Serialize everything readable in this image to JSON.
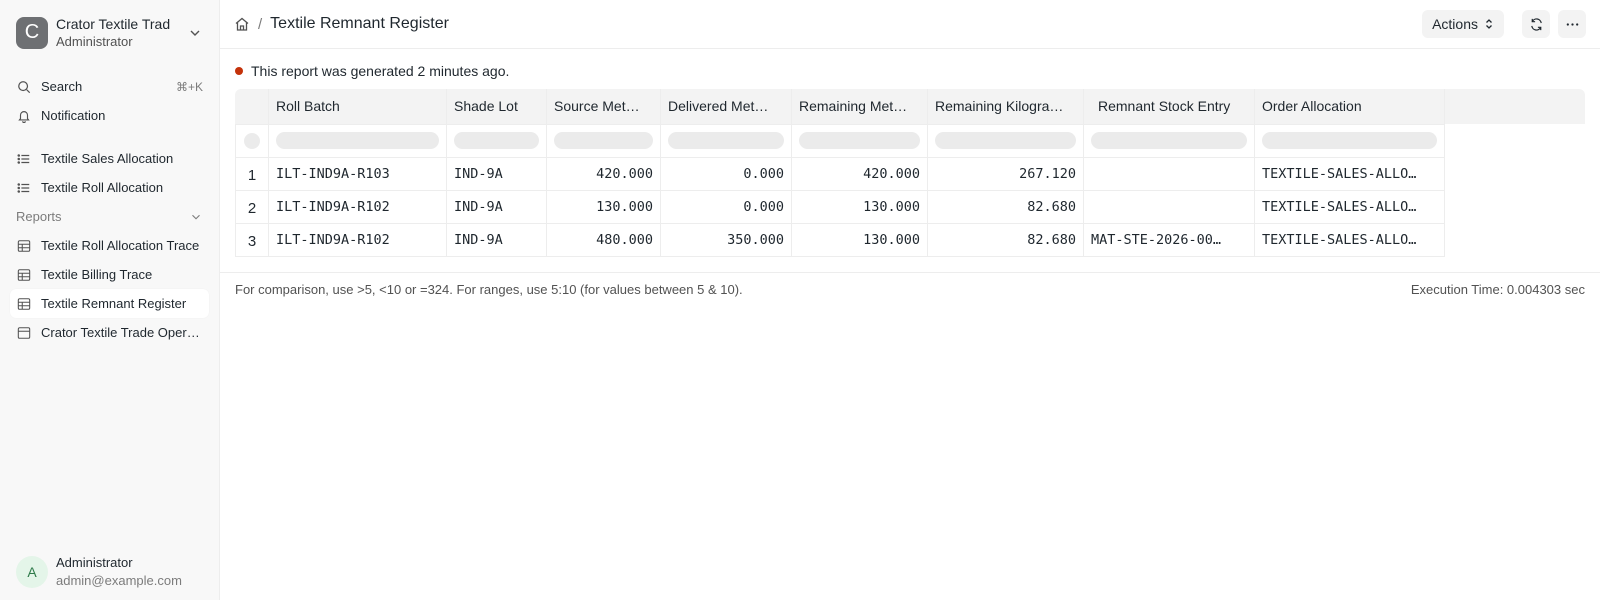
{
  "workspace": {
    "logo_letter": "C",
    "name": "Crator Textile Trad",
    "role": "Administrator"
  },
  "nav": {
    "search_label": "Search",
    "search_shortcut": "⌘+K",
    "notification_label": "Notification",
    "items": [
      {
        "label": "Textile Sales Allocation",
        "icon": "list-icon"
      },
      {
        "label": "Textile Roll Allocation",
        "icon": "list-icon"
      }
    ],
    "reports_section": "Reports",
    "reports": [
      {
        "label": "Textile Roll Allocation Trace",
        "icon": "table-icon"
      },
      {
        "label": "Textile Billing Trace",
        "icon": "table-icon"
      },
      {
        "label": "Textile Remnant Register",
        "icon": "table-icon",
        "active": true
      },
      {
        "label": "Crator Textile Trade Operations",
        "icon": "sheet-icon"
      }
    ]
  },
  "user": {
    "avatar_letter": "A",
    "name": "Administrator",
    "email": "admin@example.com"
  },
  "header": {
    "separator": "/",
    "title": "Textile Remnant Register",
    "actions_label": "Actions"
  },
  "status": {
    "message": "This report was generated 2 minutes ago.",
    "color": "#c4320a"
  },
  "table": {
    "columns": [
      "Roll Batch",
      "Shade Lot",
      "Source Meters",
      "Delivered Meters",
      "Remaining Meters",
      "Remaining Kilograms",
      "Remnant Stock Entry",
      "Order Allocation"
    ],
    "column_display": [
      "Roll Batch",
      "Shade Lot",
      "Source Met…",
      "Delivered Met…",
      "Remaining Met…",
      "Remaining Kilogra…",
      "Remnant Stock Entry",
      "Order Allocation"
    ],
    "rows": [
      {
        "idx": "1",
        "roll_batch": "ILT-IND9A-R103",
        "shade_lot": "IND-9A",
        "source": "420.000",
        "delivered": "0.000",
        "remaining": "420.000",
        "kg": "267.120",
        "stock_entry": "",
        "allocation": "TEXTILE-SALES-ALLO…"
      },
      {
        "idx": "2",
        "roll_batch": "ILT-IND9A-R102",
        "shade_lot": "IND-9A",
        "source": "130.000",
        "delivered": "0.000",
        "remaining": "130.000",
        "kg": "82.680",
        "stock_entry": "",
        "allocation": "TEXTILE-SALES-ALLO…"
      },
      {
        "idx": "3",
        "roll_batch": "ILT-IND9A-R102",
        "shade_lot": "IND-9A",
        "source": "480.000",
        "delivered": "350.000",
        "remaining": "130.000",
        "kg": "82.680",
        "stock_entry": "MAT-STE-2026-00…",
        "allocation": "TEXTILE-SALES-ALLO…"
      }
    ]
  },
  "footer": {
    "hint": "For comparison, use >5, <10 or =324. For ranges, use 5:10 (for values between 5 & 10).",
    "execution_time": "Execution Time: 0.004303 sec"
  }
}
